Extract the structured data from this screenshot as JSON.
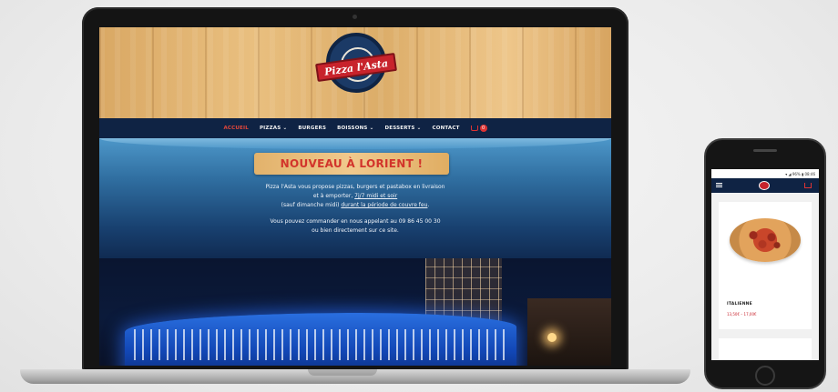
{
  "site": {
    "logo_text": "Pizza l'Asta",
    "nav": [
      {
        "label": "ACCUEIL",
        "active": true
      },
      {
        "label": "PIZZAS ⌄",
        "active": false
      },
      {
        "label": "BURGERS",
        "active": false
      },
      {
        "label": "BOISSONS ⌄",
        "active": false
      },
      {
        "label": "DESSERTS ⌄",
        "active": false
      },
      {
        "label": "CONTACT",
        "active": false
      }
    ],
    "cart_count": "0",
    "hero": {
      "title": "NOUVEAU À LORIENT !",
      "line1": "Pizza l'Asta vous propose pizzas, burgers et pastabox en livraison",
      "line2_pre": "et à emporter, ",
      "line2_link": "7j/7 midi et soir",
      "line3_pre": "(sauf dimanche midi) ",
      "line3_link": "durant la période de couvre feu",
      "line3_post": ".",
      "line4": "Vous pouvez commander en nous appelant au 09 86 45 00 30",
      "line5": "ou bien directement sur ce site."
    }
  },
  "phone": {
    "status": "▾ ◢ 96% ▮ 08:46",
    "product": {
      "name": "ITALIENNE",
      "price": "13,50€ – 17,00€"
    }
  },
  "colors": {
    "nav_bg": "#0f2344",
    "accent_red": "#d2342b",
    "hero_top": "#4d97c9"
  }
}
